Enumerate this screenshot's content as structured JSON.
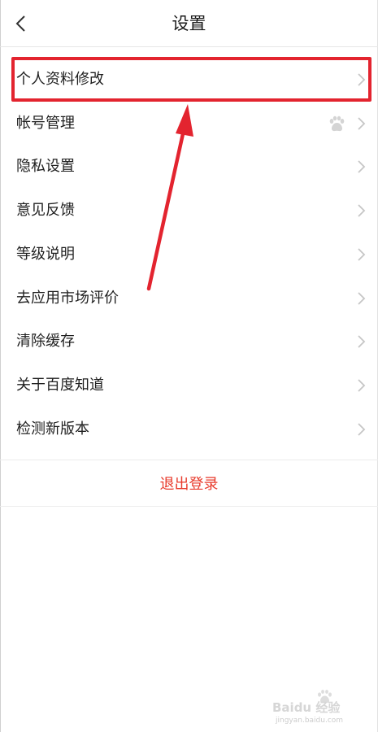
{
  "header": {
    "title": "设置"
  },
  "menu": {
    "items": [
      {
        "label": "个人资料修改"
      },
      {
        "label": "帐号管理"
      },
      {
        "label": "隐私设置"
      },
      {
        "label": "意见反馈"
      },
      {
        "label": "等级说明"
      },
      {
        "label": "去应用市场评价"
      },
      {
        "label": "清除缓存"
      },
      {
        "label": "关于百度知道"
      },
      {
        "label": "检测新版本"
      }
    ]
  },
  "logout": {
    "label": "退出登录"
  },
  "watermark": {
    "brand": "Baidu 经验",
    "url": "jingyan.baidu.com"
  },
  "colors": {
    "accent": "#e83a2b",
    "annotation": "#e3242f",
    "chevron": "#c6c6c6"
  },
  "icons": {
    "back": "chevron-left-icon",
    "chevron": "chevron-right-icon",
    "account": "baidu-paw-icon"
  }
}
